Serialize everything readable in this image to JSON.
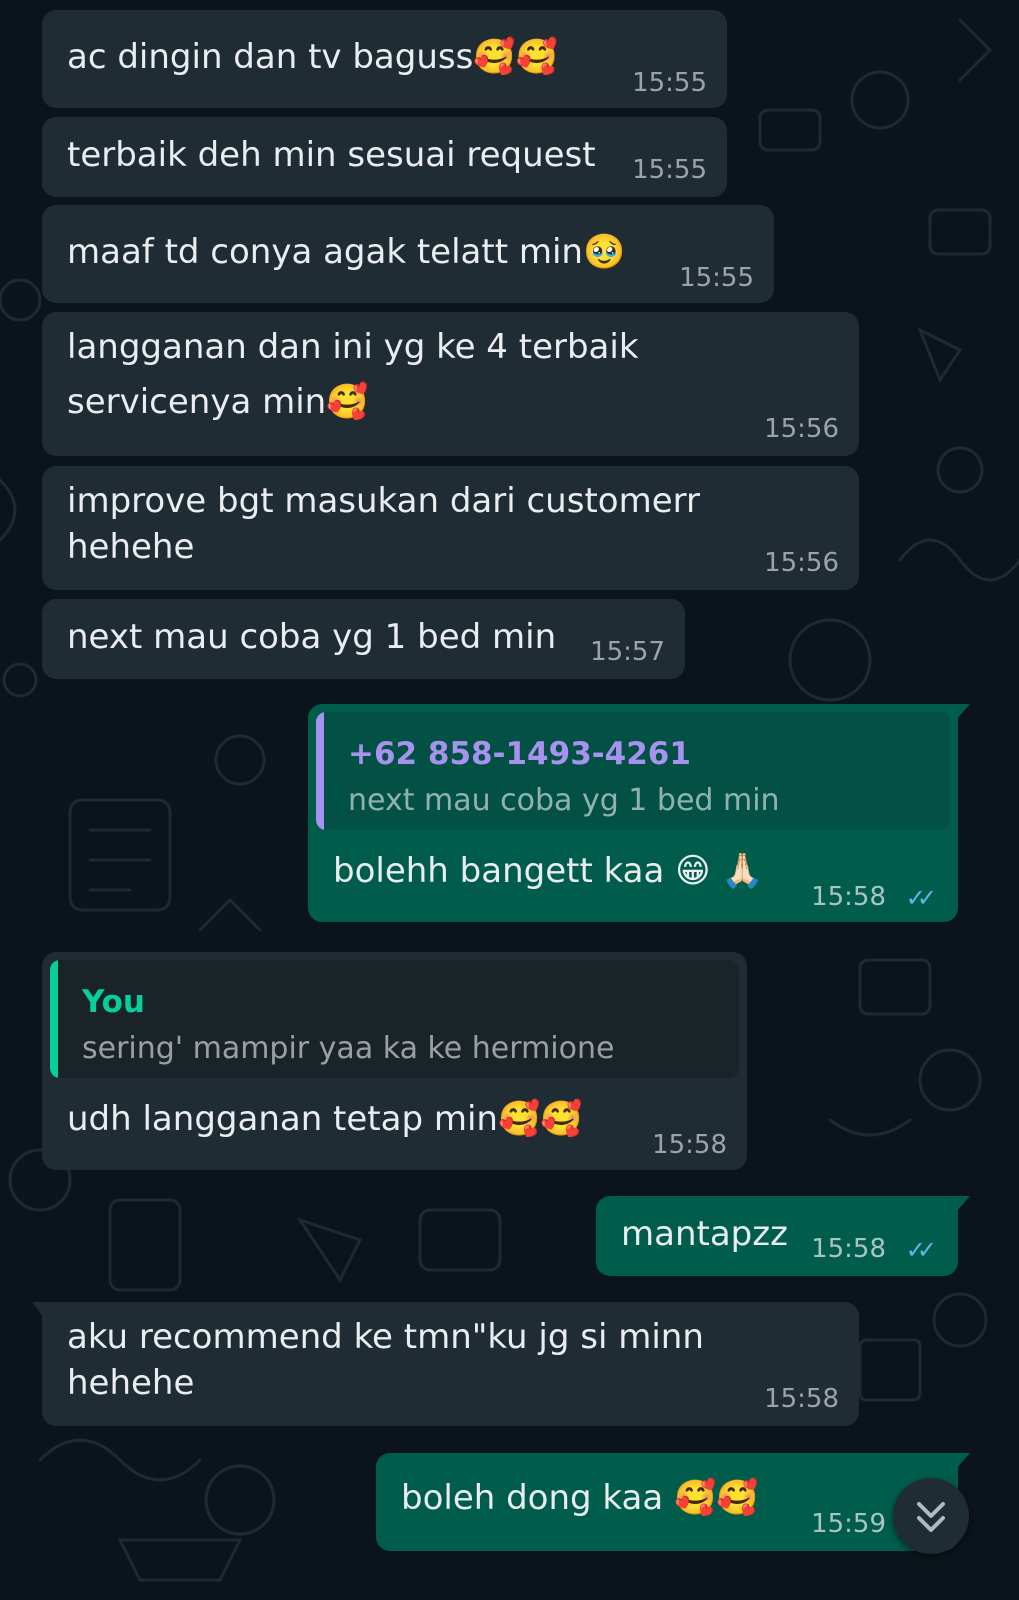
{
  "colors": {
    "background": "#0b141a",
    "incoming_bubble": "#202c33",
    "outgoing_bubble": "#005c4b",
    "read_ticks": "#53bdeb",
    "quote_author_phone": "#a792ef",
    "quote_author_you": "#06cf9c"
  },
  "messages": [
    {
      "text": "ac dingin dan tv baguss",
      "emoji": "🥰🥰",
      "time": "15:55"
    },
    {
      "text": "terbaik deh min sesuai request",
      "emoji": "",
      "time": "15:55"
    },
    {
      "text": "maaf td conya agak telatt min",
      "emoji": "🥹",
      "time": "15:55"
    },
    {
      "line1": "langganan dan ini yg ke 4 terbaik",
      "line2": "servicenya min",
      "emoji": "🥰",
      "time": "15:56"
    },
    {
      "line1": "improve bgt masukan dari customerr",
      "line2": "hehehe",
      "time": "15:56"
    },
    {
      "text": "next mau coba yg 1 bed min",
      "time": "15:57"
    },
    {
      "quote_author": "+62 858-1493-4261",
      "quote_text": "next mau coba yg 1 bed min",
      "text": "bolehh bangett kaa",
      "emoji": "😁 🙏🏻",
      "time": "15:58",
      "status": "read-ticks"
    },
    {
      "quote_author": "You",
      "quote_text": "sering' mampir yaa ka ke hermione",
      "text": "udh langganan tetap min",
      "emoji": "🥰🥰",
      "time": "15:58"
    },
    {
      "text": "mantapzz",
      "time": "15:58",
      "status": "read-ticks"
    },
    {
      "line1": "aku recommend ke tmn\"ku jg si minn",
      "line2": "hehehe",
      "time": "15:58"
    },
    {
      "text": "boleh dong kaa",
      "emoji": "🥰🥰",
      "time": "15:59"
    }
  ],
  "scroll_button_icon": "double-chevron-down-icon"
}
